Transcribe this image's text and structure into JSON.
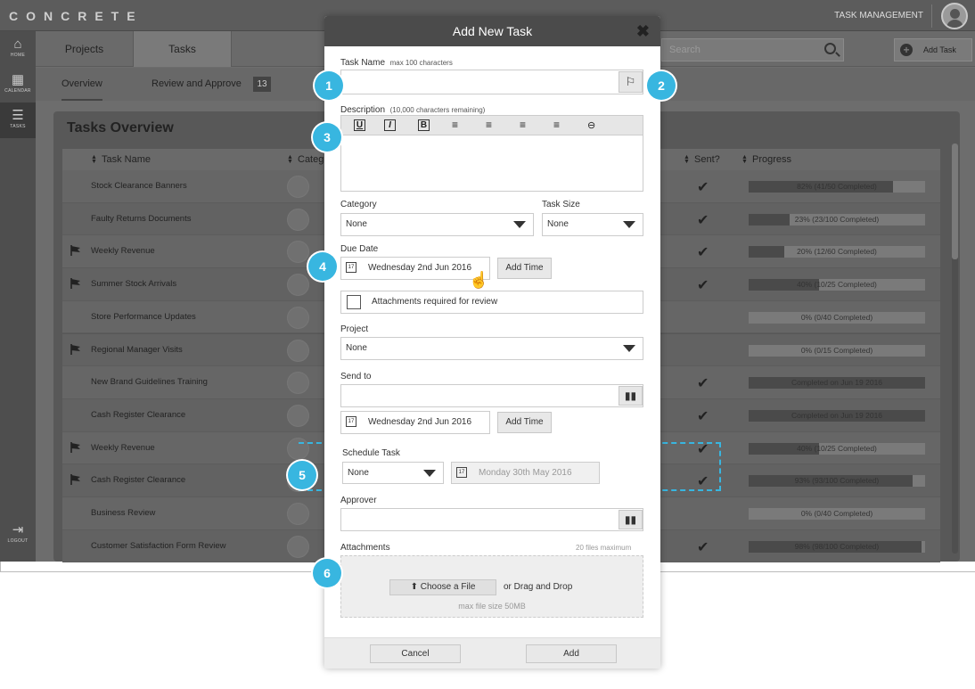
{
  "app": {
    "logo": "CONCRETE",
    "section_title": "TASK MANAGEMENT"
  },
  "sidebar": {
    "items": [
      {
        "label": "HOME",
        "icon": "home-icon"
      },
      {
        "label": "CALENDAR",
        "icon": "calendar-icon"
      },
      {
        "label": "TASKS",
        "icon": "list-icon"
      }
    ],
    "logout": "LOGOUT"
  },
  "header": {
    "tabs": [
      "Projects",
      "Tasks"
    ],
    "search_placeholder": "Search",
    "add_task": "Add Task"
  },
  "subtabs": {
    "overview": "Overview",
    "review": "Review and Approve",
    "review_count": "13"
  },
  "panel": {
    "title": "Tasks Overview",
    "col_name": "Task Name",
    "col_category": "Categ",
    "col_sent": "Sent?",
    "col_progress": "Progress"
  },
  "rows": [
    {
      "name": "Stock Clearance Banners",
      "flag": false,
      "sent": true,
      "progress": 0.82,
      "label": "82% (41/50 Completed)"
    },
    {
      "name": "Faulty Returns Documents",
      "flag": false,
      "sent": true,
      "progress": 0.23,
      "label": "23% (23/100 Completed)"
    },
    {
      "name": "Weekly Revenue",
      "flag": true,
      "sent": true,
      "progress": 0.2,
      "label": "20% (12/60 Completed)"
    },
    {
      "name": "Summer Stock Arrivals",
      "flag": true,
      "sent": true,
      "progress": 0.4,
      "label": "40% (10/25 Completed)"
    },
    {
      "name": "Store Performance Updates",
      "flag": false,
      "sent": false,
      "progress": 0,
      "label": "0% (0/40 Completed)"
    },
    {
      "name": "Regional Manager Visits",
      "flag": true,
      "sent": false,
      "progress": 0,
      "label": "0% (0/15 Completed)"
    },
    {
      "name": "New Brand Guidelines Training",
      "flag": false,
      "sent": true,
      "progress": 1,
      "label": "Completed on Jun 19 2016"
    },
    {
      "name": "Cash Register Clearance",
      "flag": false,
      "sent": true,
      "progress": 1,
      "label": "Completed on Jun 19 2016"
    },
    {
      "name": "Weekly Revenue",
      "flag": true,
      "sent": true,
      "progress": 0.4,
      "label": "40% (10/25 Completed)"
    },
    {
      "name": "Cash Register Clearance",
      "flag": true,
      "sent": true,
      "progress": 0.93,
      "label": "93% (93/100 Completed)"
    },
    {
      "name": "Business Review",
      "flag": false,
      "sent": false,
      "progress": 0,
      "label": "0% (0/40 Completed)"
    },
    {
      "name": "Customer Satisfaction Form Review",
      "flag": false,
      "sent": true,
      "progress": 0.98,
      "label": "98% (98/100 Completed)"
    }
  ],
  "modal": {
    "title": "Add New Task",
    "task_name": "Task Name",
    "task_name_hint": "max 100 characters",
    "description": "Description",
    "description_hint": "(10,000 characters remaining)",
    "category": "Category",
    "category_value": "None",
    "task_size": "Task Size",
    "task_size_value": "None",
    "due_date": "Due Date",
    "due_date_value": "Wednesday 2nd Jun 2016",
    "add_time": "Add Time",
    "attachments_required": "Attachments required for review",
    "project": "Project",
    "project_value": "None",
    "send_to": "Send to",
    "send_date_value": "Wednesday 2nd Jun 2016",
    "schedule_task": "Schedule Task",
    "schedule_value": "None",
    "schedule_date": "Monday 30th May 2016",
    "approver": "Approver",
    "attachments": "Attachments",
    "attachments_max": "20 files maximum",
    "choose_file": "Choose a File",
    "drag_drop": "or Drag and Drop",
    "max_size": "max file size 50MB",
    "cancel": "Cancel",
    "add": "Add"
  },
  "markers": [
    "1",
    "2",
    "3",
    "4",
    "5",
    "6"
  ],
  "colors": {
    "accent": "#38b6e0",
    "header": "#4b4b4b"
  }
}
